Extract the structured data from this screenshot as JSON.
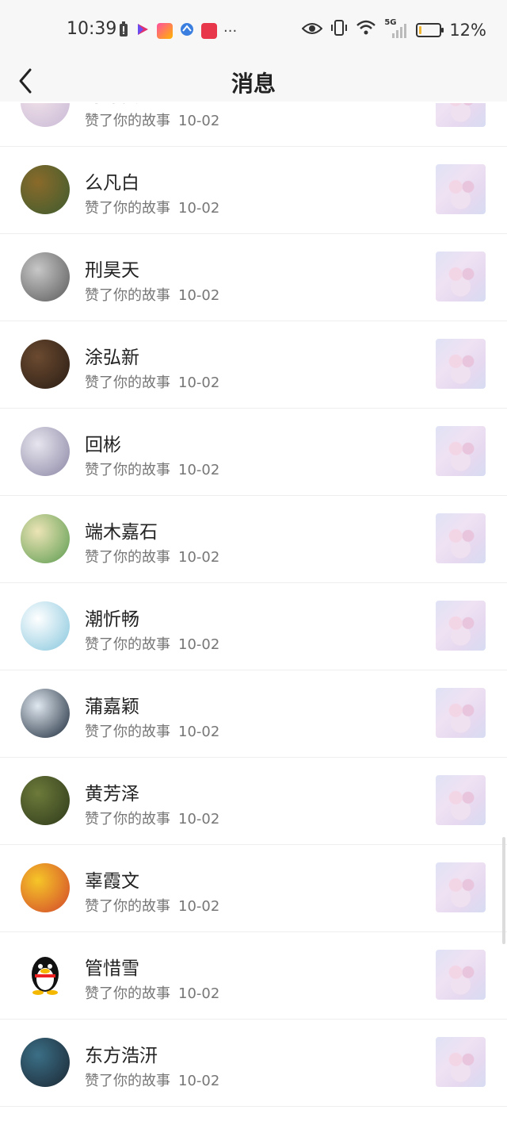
{
  "status_bar": {
    "time": "10:39",
    "battery_text": "12%",
    "battery_level": 0.12,
    "network": "5G",
    "left_icons": [
      "battery-alert-icon",
      "video-app-icon",
      "photo-app-icon",
      "browser-app-icon",
      "reader-app-icon"
    ],
    "more": "···"
  },
  "header": {
    "back_icon": "chevron-left-icon",
    "title": "消息"
  },
  "list": {
    "items": [
      {
        "name": "与孙贤",
        "action": "赞了你的故事",
        "date": "10-02",
        "avatar_colors": [
          "#f2e3ea",
          "#c9b9d6"
        ]
      },
      {
        "name": "么凡白",
        "action": "赞了你的故事",
        "date": "10-02",
        "avatar_colors": [
          "#8a6a2a",
          "#3d5c2f"
        ]
      },
      {
        "name": "刑昊天",
        "action": "赞了你的故事",
        "date": "10-02",
        "avatar_colors": [
          "#c7c7c7",
          "#5a5a5a"
        ]
      },
      {
        "name": "涂弘新",
        "action": "赞了你的故事",
        "date": "10-02",
        "avatar_colors": [
          "#6b4a30",
          "#2a1d14"
        ]
      },
      {
        "name": "回彬",
        "action": "赞了你的故事",
        "date": "10-02",
        "avatar_colors": [
          "#e7e5ee",
          "#8b86a5"
        ]
      },
      {
        "name": "端木嘉石",
        "action": "赞了你的故事",
        "date": "10-02",
        "avatar_colors": [
          "#ece4b5",
          "#5a9b4f"
        ]
      },
      {
        "name": "潮忻畅",
        "action": "赞了你的故事",
        "date": "10-02",
        "avatar_colors": [
          "#ffffff",
          "#86c6dd"
        ]
      },
      {
        "name": "蒲嘉颖",
        "action": "赞了你的故事",
        "date": "10-02",
        "avatar_colors": [
          "#dfe7ef",
          "#1c2a3a"
        ]
      },
      {
        "name": "黄芳泽",
        "action": "赞了你的故事",
        "date": "10-02",
        "avatar_colors": [
          "#6d7a3a",
          "#2e3a1a"
        ]
      },
      {
        "name": "辜霞文",
        "action": "赞了你的故事",
        "date": "10-02",
        "avatar_colors": [
          "#f6c628",
          "#d2462b"
        ]
      },
      {
        "name": "管惜雪",
        "action": "赞了你的故事",
        "date": "10-02",
        "avatar_colors": [
          "#ffffff",
          "#ffffff"
        ]
      },
      {
        "name": "东方浩汧",
        "action": "赞了你的故事",
        "date": "10-02",
        "avatar_colors": [
          "#3b6f86",
          "#1b2733"
        ]
      }
    ]
  }
}
